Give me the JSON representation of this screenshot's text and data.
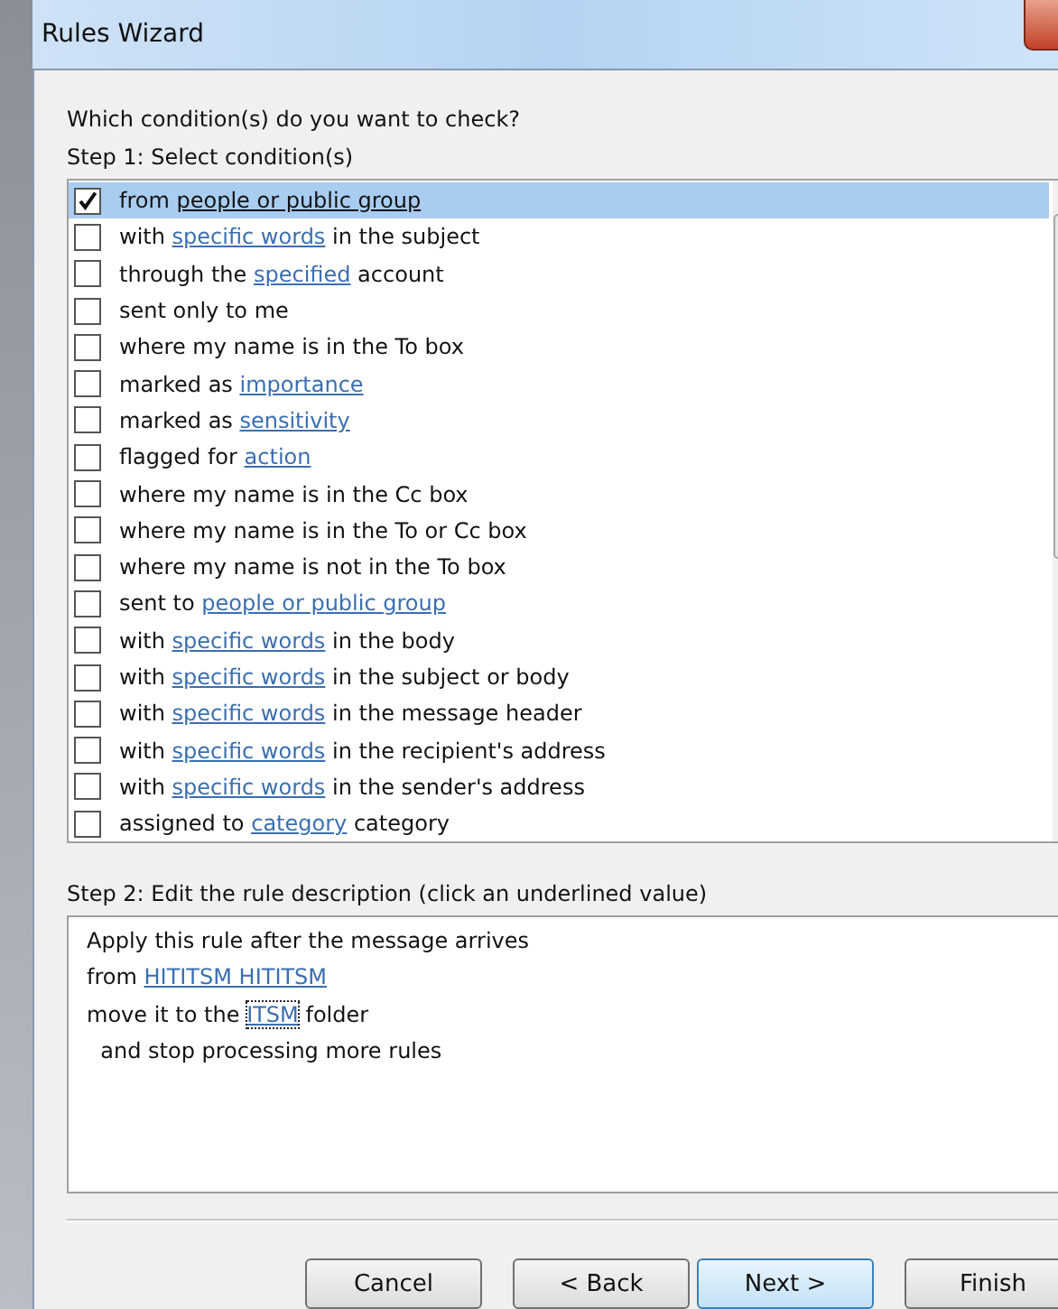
{
  "window": {
    "title": "Rules Wizard"
  },
  "prompt": "Which condition(s) do you want to check?",
  "step1_label": "Step 1: Select condition(s)",
  "conditions": [
    {
      "checked": true,
      "selected": true,
      "parts": [
        {
          "kind": "text",
          "text": "from "
        },
        {
          "kind": "link",
          "text": "people or public group"
        }
      ]
    },
    {
      "checked": false,
      "selected": false,
      "parts": [
        {
          "kind": "text",
          "text": "with "
        },
        {
          "kind": "link",
          "text": "specific words"
        },
        {
          "kind": "text",
          "text": " in the subject"
        }
      ]
    },
    {
      "checked": false,
      "selected": false,
      "parts": [
        {
          "kind": "text",
          "text": "through the "
        },
        {
          "kind": "link",
          "text": "specified"
        },
        {
          "kind": "text",
          "text": " account"
        }
      ]
    },
    {
      "checked": false,
      "selected": false,
      "parts": [
        {
          "kind": "text",
          "text": "sent only to me"
        }
      ]
    },
    {
      "checked": false,
      "selected": false,
      "parts": [
        {
          "kind": "text",
          "text": "where my name is in the To box"
        }
      ]
    },
    {
      "checked": false,
      "selected": false,
      "parts": [
        {
          "kind": "text",
          "text": "marked as "
        },
        {
          "kind": "link",
          "text": "importance"
        }
      ]
    },
    {
      "checked": false,
      "selected": false,
      "parts": [
        {
          "kind": "text",
          "text": "marked as "
        },
        {
          "kind": "link",
          "text": "sensitivity"
        }
      ]
    },
    {
      "checked": false,
      "selected": false,
      "parts": [
        {
          "kind": "text",
          "text": "flagged for "
        },
        {
          "kind": "link",
          "text": "action"
        }
      ]
    },
    {
      "checked": false,
      "selected": false,
      "parts": [
        {
          "kind": "text",
          "text": "where my name is in the Cc box"
        }
      ]
    },
    {
      "checked": false,
      "selected": false,
      "parts": [
        {
          "kind": "text",
          "text": "where my name is in the To or Cc box"
        }
      ]
    },
    {
      "checked": false,
      "selected": false,
      "parts": [
        {
          "kind": "text",
          "text": "where my name is not in the To box"
        }
      ]
    },
    {
      "checked": false,
      "selected": false,
      "parts": [
        {
          "kind": "text",
          "text": "sent to "
        },
        {
          "kind": "link",
          "text": "people or public group"
        }
      ]
    },
    {
      "checked": false,
      "selected": false,
      "parts": [
        {
          "kind": "text",
          "text": "with "
        },
        {
          "kind": "link",
          "text": "specific words"
        },
        {
          "kind": "text",
          "text": " in the body"
        }
      ]
    },
    {
      "checked": false,
      "selected": false,
      "parts": [
        {
          "kind": "text",
          "text": "with "
        },
        {
          "kind": "link",
          "text": "specific words"
        },
        {
          "kind": "text",
          "text": " in the subject or body"
        }
      ]
    },
    {
      "checked": false,
      "selected": false,
      "parts": [
        {
          "kind": "text",
          "text": "with "
        },
        {
          "kind": "link",
          "text": "specific words"
        },
        {
          "kind": "text",
          "text": " in the message header"
        }
      ]
    },
    {
      "checked": false,
      "selected": false,
      "parts": [
        {
          "kind": "text",
          "text": "with "
        },
        {
          "kind": "link",
          "text": "specific words"
        },
        {
          "kind": "text",
          "text": " in the recipient's address"
        }
      ]
    },
    {
      "checked": false,
      "selected": false,
      "parts": [
        {
          "kind": "text",
          "text": "with "
        },
        {
          "kind": "link",
          "text": "specific words"
        },
        {
          "kind": "text",
          "text": " in the sender's address"
        }
      ]
    },
    {
      "checked": false,
      "selected": false,
      "parts": [
        {
          "kind": "text",
          "text": "assigned to "
        },
        {
          "kind": "link",
          "text": "category"
        },
        {
          "kind": "text",
          "text": " category"
        }
      ]
    }
  ],
  "step2_label": "Step 2: Edit the rule description (click an underlined value)",
  "description": [
    {
      "parts": [
        {
          "kind": "text",
          "text": "Apply this rule after the message arrives"
        }
      ]
    },
    {
      "parts": [
        {
          "kind": "text",
          "text": "from "
        },
        {
          "kind": "link",
          "text": "HITITSM HITITSM",
          "focused": false
        }
      ]
    },
    {
      "parts": [
        {
          "kind": "text",
          "text": "move it to the "
        },
        {
          "kind": "link",
          "text": "ITSM",
          "focused": true
        },
        {
          "kind": "text",
          "text": " folder"
        }
      ]
    },
    {
      "parts": [
        {
          "kind": "text",
          "text": "  and stop processing more rules"
        }
      ]
    }
  ],
  "buttons": [
    {
      "label": "Cancel",
      "default": false
    },
    {
      "label": "< Back",
      "default": false
    },
    {
      "label": "Next >",
      "default": true
    },
    {
      "label": "Finish",
      "default": false
    }
  ]
}
